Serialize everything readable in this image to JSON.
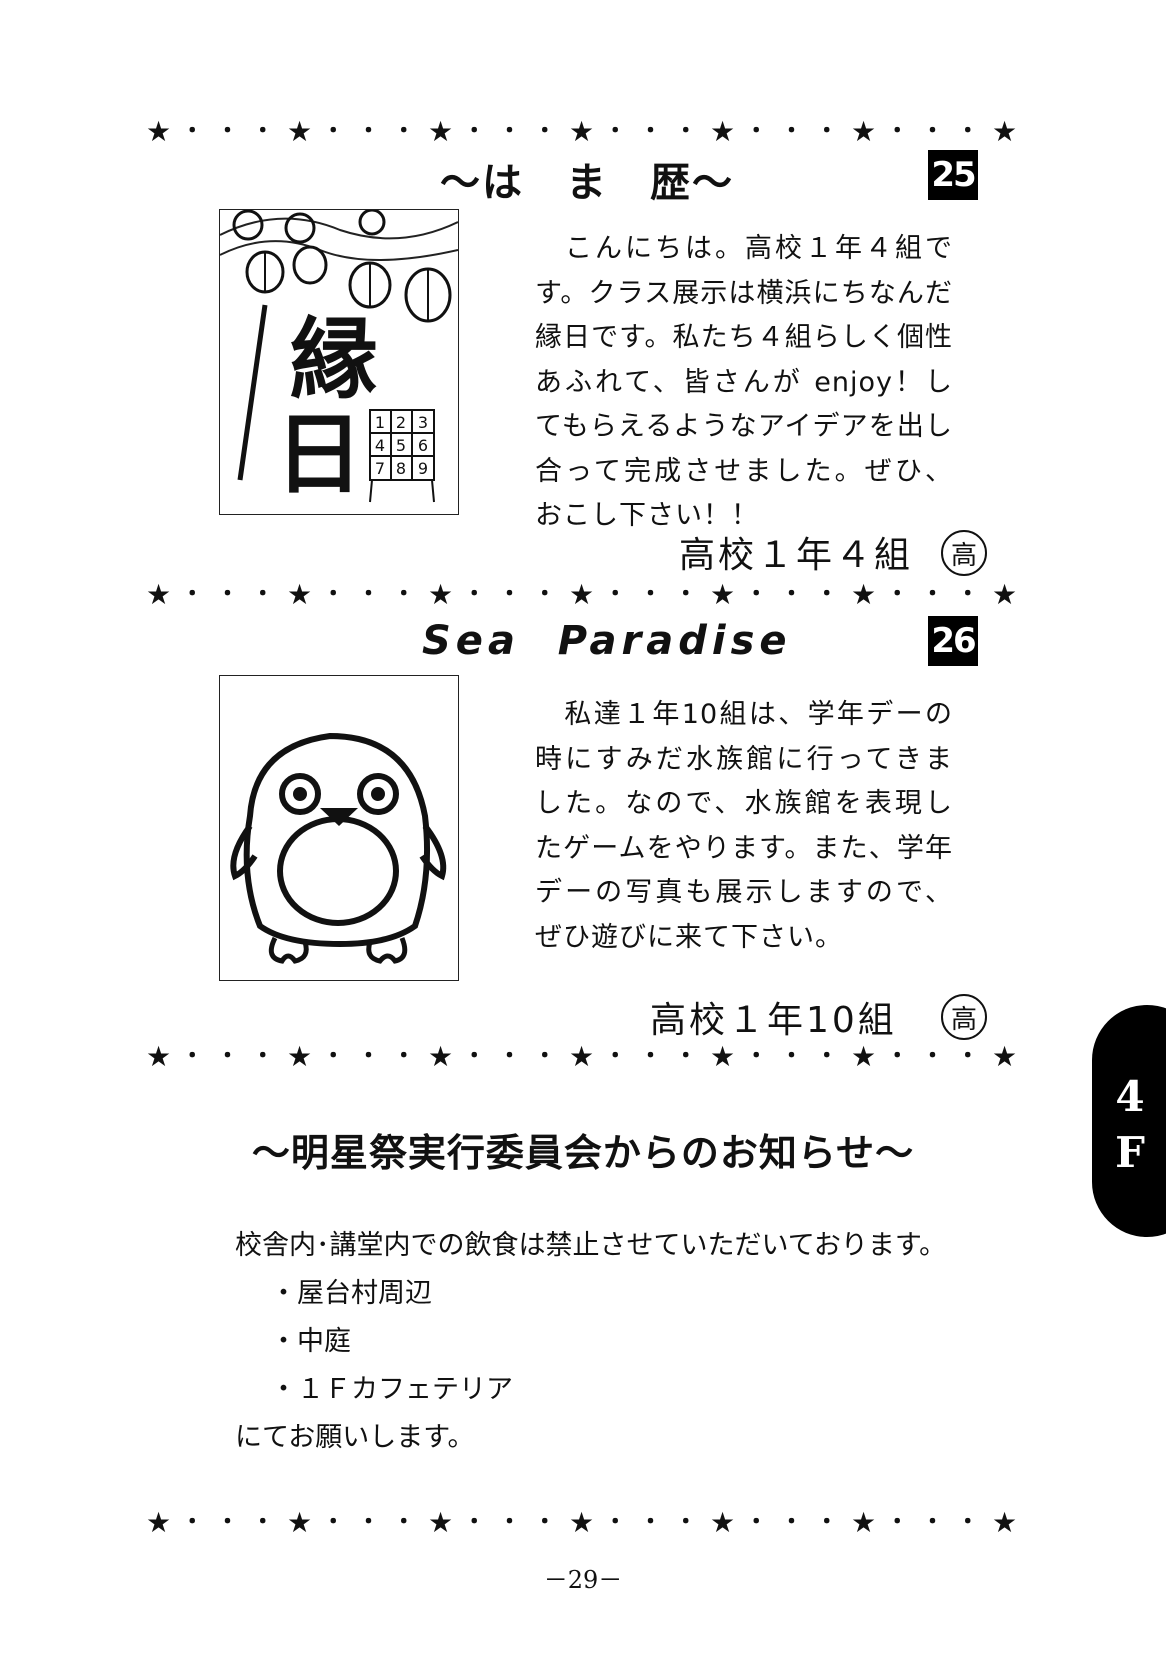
{
  "divider": {
    "glyphs": [
      "★",
      "・",
      "・",
      "・",
      "★",
      "・",
      "・",
      "・",
      "★",
      "・",
      "・",
      "・",
      "★",
      "・",
      "・",
      "・",
      "★",
      "・",
      "・",
      "・",
      "★",
      "・",
      "・",
      "・",
      "★"
    ]
  },
  "section1": {
    "title": "～は　ま　歴～",
    "number": "25",
    "illustration_text": "縁日",
    "grid_digits": [
      "1",
      "2",
      "3",
      "4",
      "5",
      "6",
      "7",
      "8",
      "9"
    ],
    "body": "　こんにちは。高校１年４組です。クラス展示は横浜にちなんだ縁日です。私たち４組らしく個性あふれて、皆さんが enjoy！してもらえるようなアイデアを出し合って完成させました。ぜひ、おこし下さい！！",
    "signature": "高校１年４組",
    "badge": "高"
  },
  "section2": {
    "title": "Sea  Paradise",
    "number": "26",
    "body": "　私達１年10組は、学年デーの時にすみだ水族館に行ってきました。なので、水族館を表現したゲームをやります。また、学年デーの写真も展示しますので、ぜひ遊びに来て下さい。",
    "signature": "高校１年10組",
    "badge": "高"
  },
  "notice": {
    "title": "～明星祭実行委員会からのお知らせ～",
    "intro": "校舎内･講堂内での飲食は禁止させていただいております。",
    "items": [
      "・屋台村周辺",
      "・中庭",
      "・１Ｆカフェテリア"
    ],
    "outro": "にてお願いします。"
  },
  "tab": {
    "line1": "4",
    "line2": "F"
  },
  "page_number": "－29－"
}
